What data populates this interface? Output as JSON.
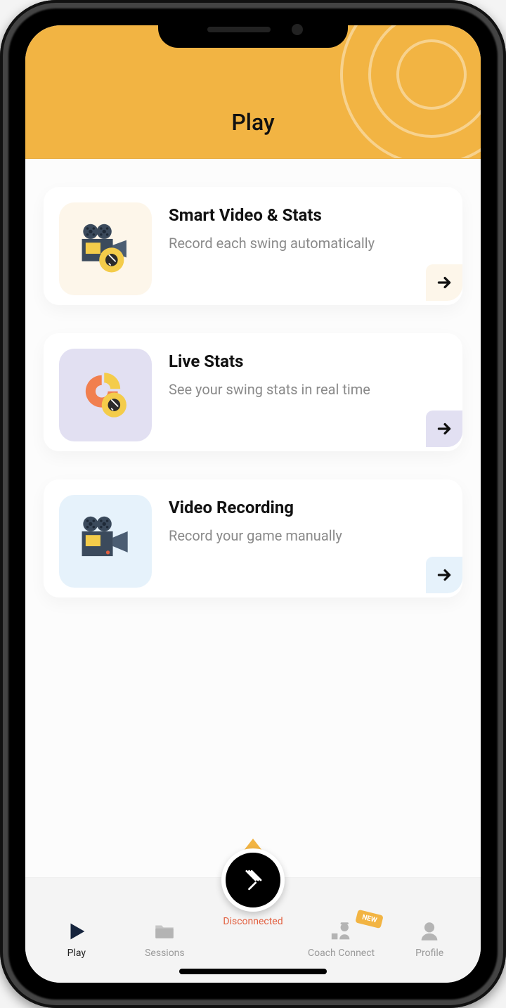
{
  "header": {
    "title": "Play"
  },
  "cards": [
    {
      "title": "Smart Video & Stats",
      "subtitle": "Record each swing automatically",
      "arrow_class": "cream",
      "icon_class": "cream",
      "icon_name": "video-stats-icon"
    },
    {
      "title": "Live Stats",
      "subtitle": "See your swing stats in real time",
      "arrow_class": "lav",
      "icon_class": "lav",
      "icon_name": "live-stats-icon"
    },
    {
      "title": "Video Recording",
      "subtitle": "Record your game manually",
      "arrow_class": "sky",
      "icon_class": "sky",
      "icon_name": "video-recording-icon"
    }
  ],
  "nav": {
    "items": [
      {
        "label": "Play",
        "icon": "play-icon",
        "active": true
      },
      {
        "label": "Sessions",
        "icon": "folder-icon",
        "active": false
      },
      {
        "label": "Disconnected",
        "center": true,
        "label_color": "#e25f3f"
      },
      {
        "label": "Coach Connect",
        "icon": "coach-icon",
        "active": false,
        "badge": "NEW"
      },
      {
        "label": "Profile",
        "icon": "profile-icon",
        "active": false
      }
    ]
  }
}
